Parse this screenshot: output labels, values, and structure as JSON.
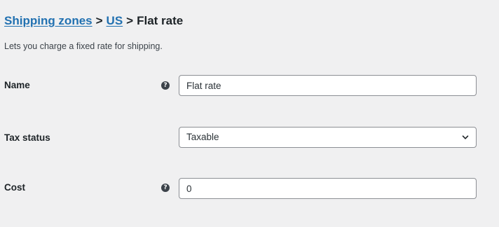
{
  "breadcrumb": {
    "items": [
      {
        "label": "Shipping zones"
      },
      {
        "label": "US"
      }
    ],
    "separator": ">",
    "current": "Flat rate"
  },
  "description": "Lets you charge a fixed rate for shipping.",
  "fields": {
    "name": {
      "label": "Name",
      "value": "Flat rate",
      "help_icon": "question-circle-icon"
    },
    "tax_status": {
      "label": "Tax status",
      "selected": "Taxable",
      "icon": "chevron-down-icon"
    },
    "cost": {
      "label": "Cost",
      "value": "0",
      "help_icon": "question-circle-icon"
    }
  },
  "colors": {
    "background": "#f0f0f1",
    "link": "#2271b1",
    "text": "#1d2327",
    "input_border": "#8c8f94"
  }
}
